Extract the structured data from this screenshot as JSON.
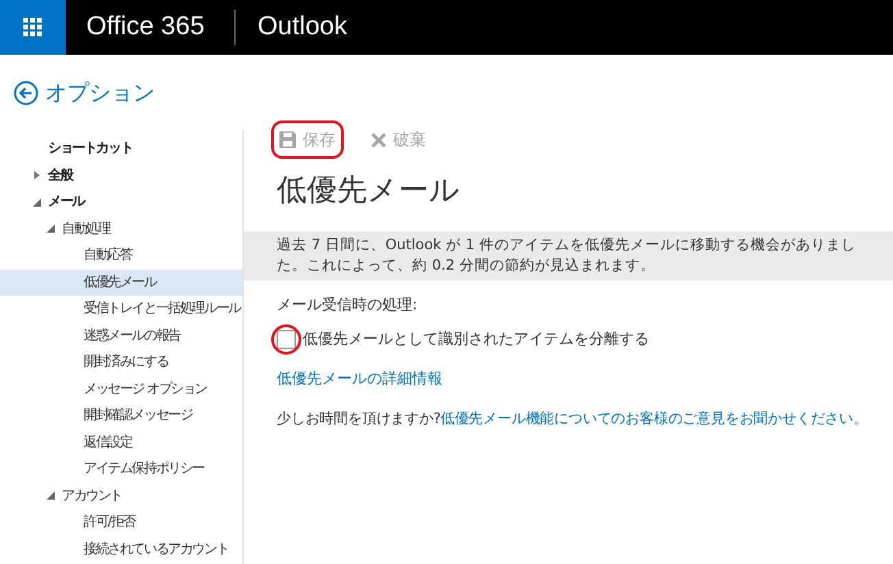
{
  "header": {
    "product": "Office 365",
    "app": "Outlook"
  },
  "back_link": "オプション",
  "sidebar": {
    "items": [
      {
        "label": "ショートカット",
        "selected": false
      },
      {
        "label": "全般",
        "selected": false,
        "expanded": false
      },
      {
        "label": "メール",
        "selected": false,
        "expanded": true,
        "children": [
          {
            "label": "自動処理",
            "selected": false,
            "expanded": true,
            "children": [
              {
                "label": "自動応答",
                "selected": false
              },
              {
                "label": "低優先メール",
                "selected": true
              },
              {
                "label": "受信トレイと一括処理ルール",
                "selected": false
              },
              {
                "label": "迷惑メールの報告",
                "selected": false
              },
              {
                "label": "開封済みにする",
                "selected": false
              },
              {
                "label": "メッセージ オプション",
                "selected": false
              },
              {
                "label": "開封確認メッセージ",
                "selected": false
              },
              {
                "label": "返信設定",
                "selected": false
              },
              {
                "label": "アイテム保持ポリシー",
                "selected": false
              }
            ]
          },
          {
            "label": "アカウント",
            "selected": false,
            "expanded": true,
            "children": [
              {
                "label": "許可/拒否",
                "selected": false
              },
              {
                "label": "接続されているアカウント",
                "selected": false
              }
            ]
          }
        ]
      }
    ]
  },
  "toolbar": [
    {
      "kind": "save",
      "label": "保存",
      "disabled": true,
      "circled": true
    },
    {
      "kind": "discard",
      "label": "破棄",
      "disabled": true,
      "circled": false
    }
  ],
  "title": "低優先メール",
  "info_bar": "過去 7 日間に、Outlook が 1 件のアイテムを低優先メールに移動する機会がありました。これによって、約 0.2 分間の節約が見込まれます。",
  "section_label": "メール受信時の処理:",
  "checkbox": {
    "label": "低優先メールとして識別されたアイテムを分離する",
    "checked": false,
    "circled": true
  },
  "details_link": "低優先メールの詳細情報",
  "feedback": {
    "prompt": "少しお時間を頂けますか?",
    "link": "低優先メール機能についてのお客様のご意見をお聞かせください。"
  }
}
